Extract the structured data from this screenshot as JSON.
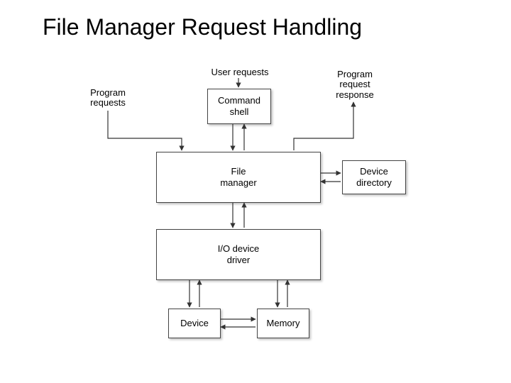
{
  "title": "File Manager Request Handling",
  "labels": {
    "program_requests": "Program\nrequests",
    "user_requests": "User requests",
    "program_request_response": "Program\nrequest\nresponse"
  },
  "boxes": {
    "command_shell": "Command\nshell",
    "file_manager": "File\nmanager",
    "device_directory": "Device\ndirectory",
    "io_device_driver": "I/O device\ndriver",
    "device": "Device",
    "memory": "Memory"
  }
}
